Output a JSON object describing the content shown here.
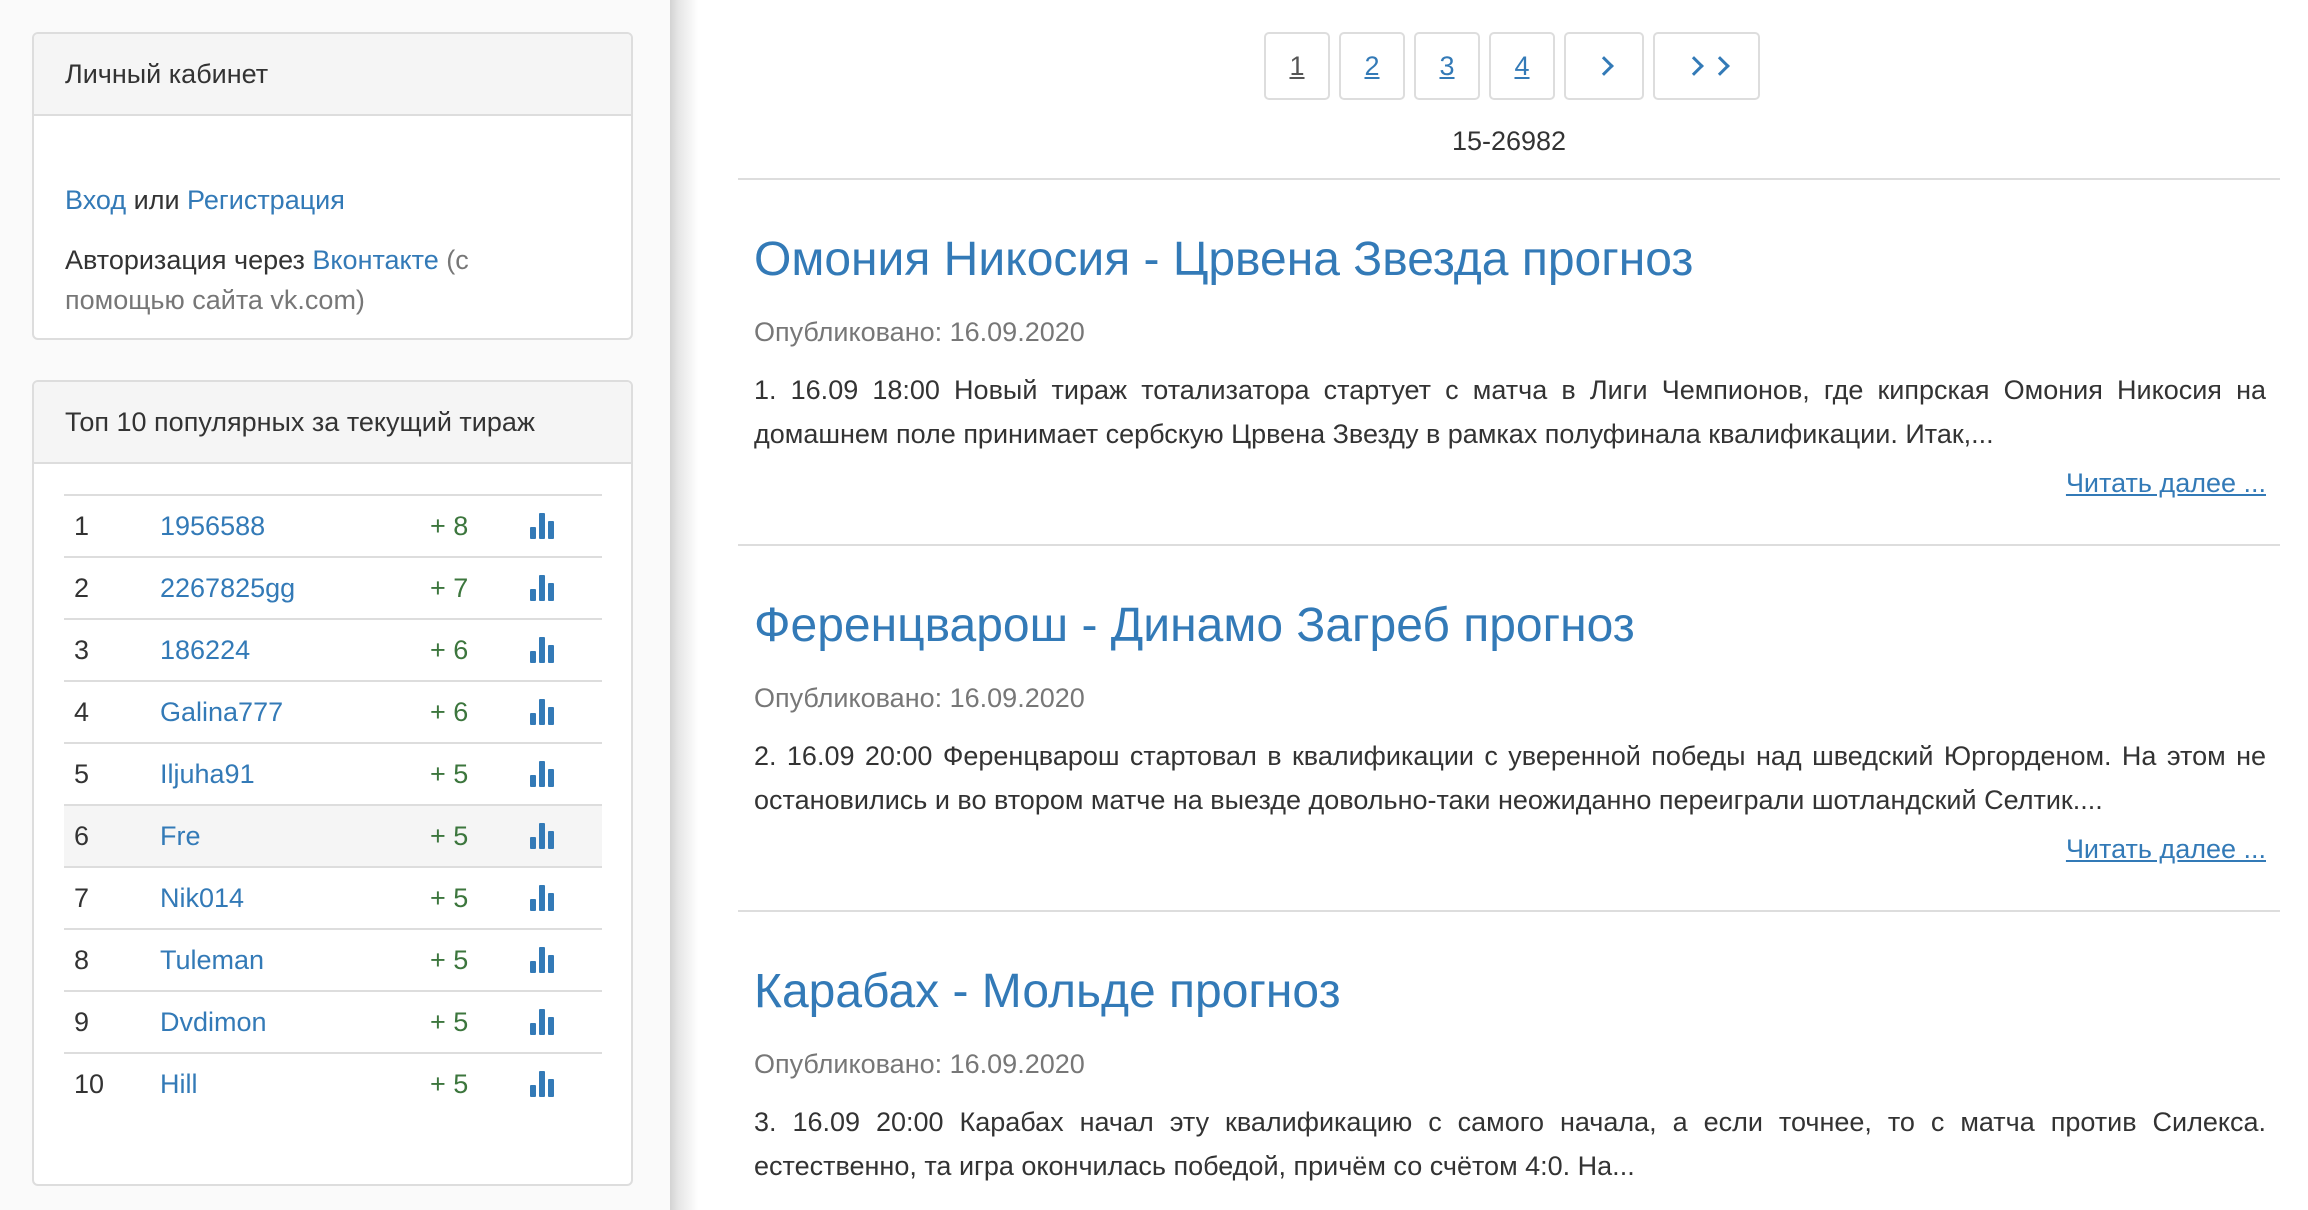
{
  "login": {
    "title": "Личный кабинет",
    "login_link": "Вход",
    "or_text": "или",
    "register_link": "Регистрация",
    "auth_via": "Авторизация через",
    "vk_link": "Вконтакте",
    "vk_note": "(с помощью сайта vk.com)"
  },
  "top": {
    "title": "Топ 10 популярных за текущий тираж",
    "rows": [
      {
        "rank": "1",
        "name": "1956588",
        "score": "+ 8"
      },
      {
        "rank": "2",
        "name": "2267825gg",
        "score": "+ 7"
      },
      {
        "rank": "3",
        "name": "186224",
        "score": "+ 6"
      },
      {
        "rank": "4",
        "name": "Galina777",
        "score": "+ 6"
      },
      {
        "rank": "5",
        "name": "Iljuha91",
        "score": "+ 5"
      },
      {
        "rank": "6",
        "name": "Fre",
        "score": "+ 5"
      },
      {
        "rank": "7",
        "name": "Nik014",
        "score": "+ 5"
      },
      {
        "rank": "8",
        "name": "Tuleman",
        "score": "+ 5"
      },
      {
        "rank": "9",
        "name": "Dvdimon",
        "score": "+ 5"
      },
      {
        "rank": "10",
        "name": "Hill",
        "score": "+ 5"
      }
    ],
    "stats_icon": "bar-chart-icon"
  },
  "pagination": {
    "pages": [
      "1",
      "2",
      "3",
      "4"
    ],
    "current": "1",
    "next_icon": "chevron-right-icon",
    "last_icon": "double-chevron-right-icon"
  },
  "range_text": "15-26982",
  "articles": [
    {
      "title": "Омония Никосия - Црвена Звезда прогноз",
      "date": "Опубликовано: 16.09.2020",
      "text": "1. 16.09 18:00 Новый тираж тотализатора стартует с матча в Лиги Чемпионов, где кипрская Омония Никосия на домашнем поле принимает сербскую Црвена Звезду в рамках полуфинала квалификации. Итак,...",
      "read_more": "Читать далее ..."
    },
    {
      "title": "Ференцварош - Динамо Загреб прогноз",
      "date": "Опубликовано: 16.09.2020",
      "text": "2. 16.09 20:00 Ференцварош стартовал в квалификации с уверенной победы над шведский Юргорденом. На этом не остановились и во втором матче на выезде довольно-таки неожиданно переиграли шотландский Селтик....",
      "read_more": "Читать далее ..."
    },
    {
      "title": "Карабах - Мольде прогноз",
      "date": "Опубликовано: 16.09.2020",
      "text": "3. 16.09 20:00 Карабах начал эту квалификацию с самого начала, а если точнее, то с матча против Силекса. естественно, та игра окончилась победой, причём со счётом 4:0. На...",
      "read_more": ""
    }
  ],
  "colors": {
    "link": "#337ab7",
    "score": "#3c763d",
    "muted": "#777777",
    "border": "#dddddd"
  }
}
